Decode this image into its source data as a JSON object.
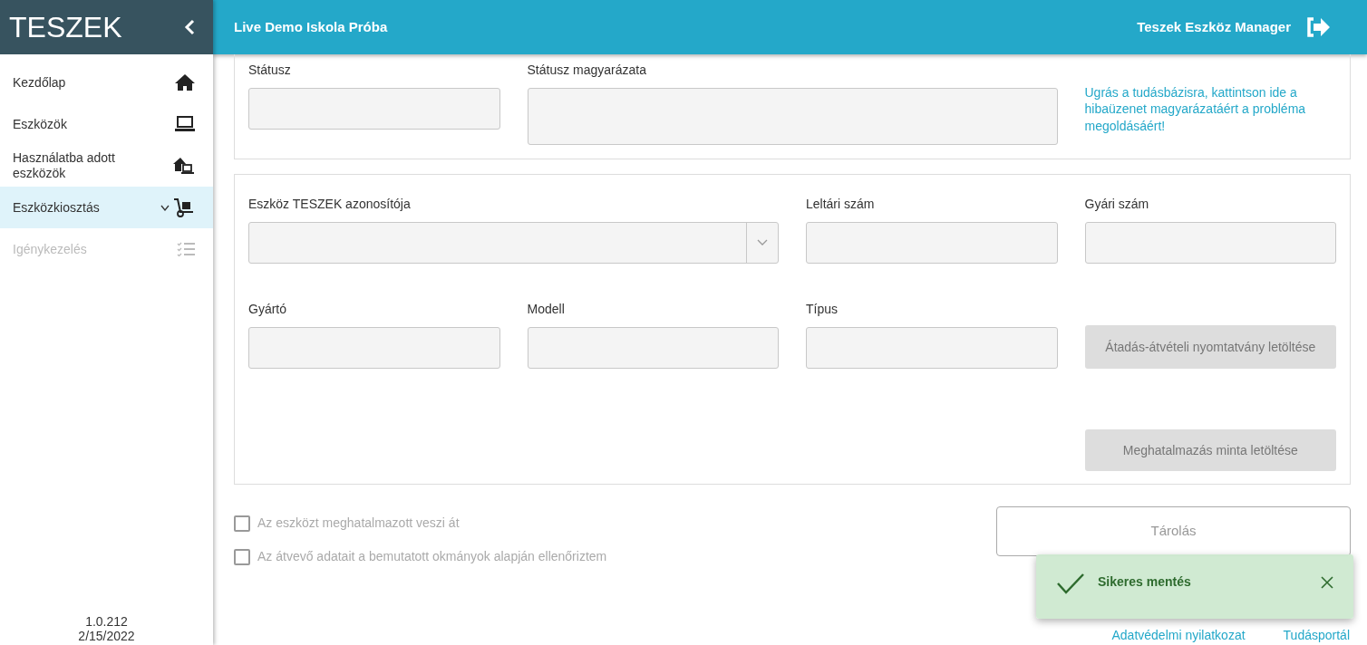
{
  "sidebar": {
    "brand": "TESZEK",
    "items": [
      {
        "label": "Kezdőlap",
        "selected": false,
        "disabled": false
      },
      {
        "label": "Eszközök",
        "selected": false,
        "disabled": false
      },
      {
        "label": "Használatba adott eszközök",
        "selected": false,
        "disabled": false
      },
      {
        "label": "Eszközkiosztás",
        "selected": true,
        "disabled": false,
        "expanded": false
      },
      {
        "label": "Igénykezelés",
        "selected": false,
        "disabled": true
      }
    ],
    "version": "1.0.212",
    "date": "2/15/2022"
  },
  "topbar": {
    "school": "Live Demo Iskola Próba",
    "user": "Teszek Eszköz Manager"
  },
  "status_card": {
    "fields": [
      {
        "label": "Státusz",
        "kind": "input"
      },
      {
        "label": "Státusz magyarázata",
        "kind": "textarea"
      }
    ],
    "help_link": "Ugrás a tudásbázisra, kattintson ide a hibaüzenet magyarázatáért a probléma megoldásáért!"
  },
  "device_card": {
    "fields": [
      {
        "label": "Eszköz TESZEK azonosítója",
        "kind": "select"
      },
      {
        "label": "Leltári szám",
        "kind": "input"
      },
      {
        "label": "Gyári szám",
        "kind": "input"
      },
      {
        "label": "Gyártó",
        "kind": "input"
      },
      {
        "label": "Modell",
        "kind": "input"
      },
      {
        "label": "Típus",
        "kind": "input"
      }
    ],
    "buttons": [
      {
        "label": "Átadás-átvételi nyomtatvány letöltése",
        "disabled": true
      },
      {
        "label": "Meghatalmazás minta letöltése",
        "disabled": true
      }
    ]
  },
  "checkboxes": [
    {
      "label": "Az eszközt meghatalmazott veszi át",
      "checked": false,
      "disabled": true
    },
    {
      "label": "Az átvevő adatait a bemutatott okmányok alapján ellenőriztem",
      "checked": false,
      "disabled": true
    }
  ],
  "save_button": {
    "label": "Tárolás",
    "disabled": true
  },
  "toast": {
    "message": "Sikeres mentés"
  },
  "footer_links": [
    "Adatvédelmi nyilatkozat",
    "Tudásportál"
  ]
}
